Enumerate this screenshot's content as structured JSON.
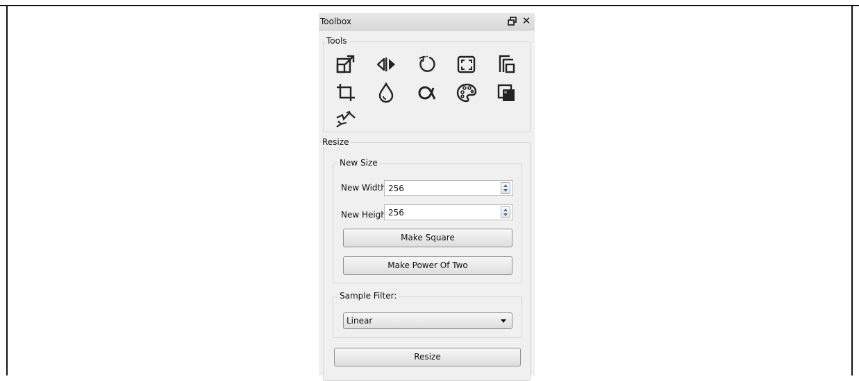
{
  "window": {
    "title": "Toolbox",
    "float_icon": "float-window-icon",
    "close_glyph": "✕",
    "close_icon": "close-icon"
  },
  "tools": {
    "group_label": "Tools",
    "icons": [
      "resize-icon",
      "flip-icon",
      "rotate-icon",
      "fit-canvas-icon",
      "canvas-size-icon",
      "crop-icon",
      "color-drop-icon",
      "alpha-icon",
      "palette-icon",
      "layer-copy-icon",
      "gradient-map-icon"
    ]
  },
  "resize": {
    "group_label": "Resize",
    "new_size": {
      "group_label": "New Size",
      "width_label": "New Width:",
      "width_value": "256",
      "height_label": "New Height:",
      "height_value": "256",
      "make_square_label": "Make Square",
      "make_power_label": "Make Power Of Two"
    },
    "sample_filter": {
      "group_label": "Sample Filter:",
      "selected": "Linear"
    },
    "resize_button_label": "Resize"
  },
  "colors": {
    "panel_bg": "#f0f0f0",
    "spin_arrow": "#3b6ea5",
    "border": "#8f8f8f"
  }
}
